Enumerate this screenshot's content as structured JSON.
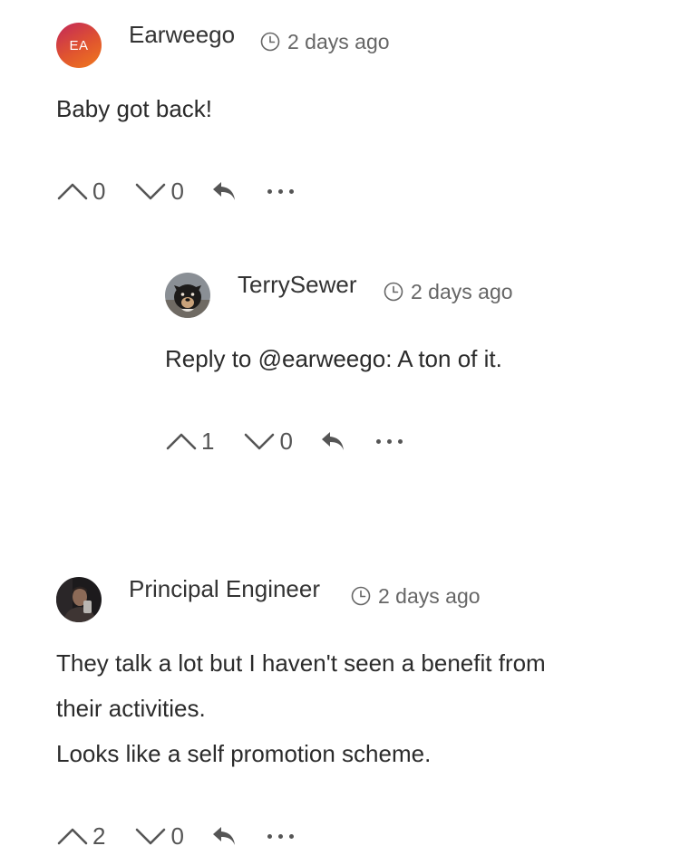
{
  "comments": [
    {
      "author": "Earweego",
      "avatar_initials": "EA",
      "time": "2 days ago",
      "lines": [
        "Baby got back!"
      ],
      "upvotes": "0",
      "downvotes": "0"
    },
    {
      "author": "TerrySewer",
      "avatar_icon": "dog-photo-avatar",
      "time": "2 days ago",
      "lines": [
        "Reply to @earweego: A ton of it."
      ],
      "upvotes": "1",
      "downvotes": "0"
    },
    {
      "author": "Principal Engineer",
      "avatar_icon": "person-photo-avatar",
      "time": "2 days ago",
      "lines": [
        "They talk a lot but I haven't seen a benefit from",
        "their activities.",
        "Looks like a self promotion scheme."
      ],
      "upvotes": "2",
      "downvotes": "0"
    }
  ],
  "icons": {
    "clock": "clock-icon",
    "upvote": "chevron-up-icon",
    "downvote": "chevron-down-icon",
    "reply": "reply-arrow-icon",
    "more": "more-dots-icon"
  },
  "colors": {
    "avatar_gradient_start": "#c2275a",
    "avatar_gradient_end": "#f07a1d",
    "text": "#2b2b2b",
    "muted": "#666666"
  }
}
